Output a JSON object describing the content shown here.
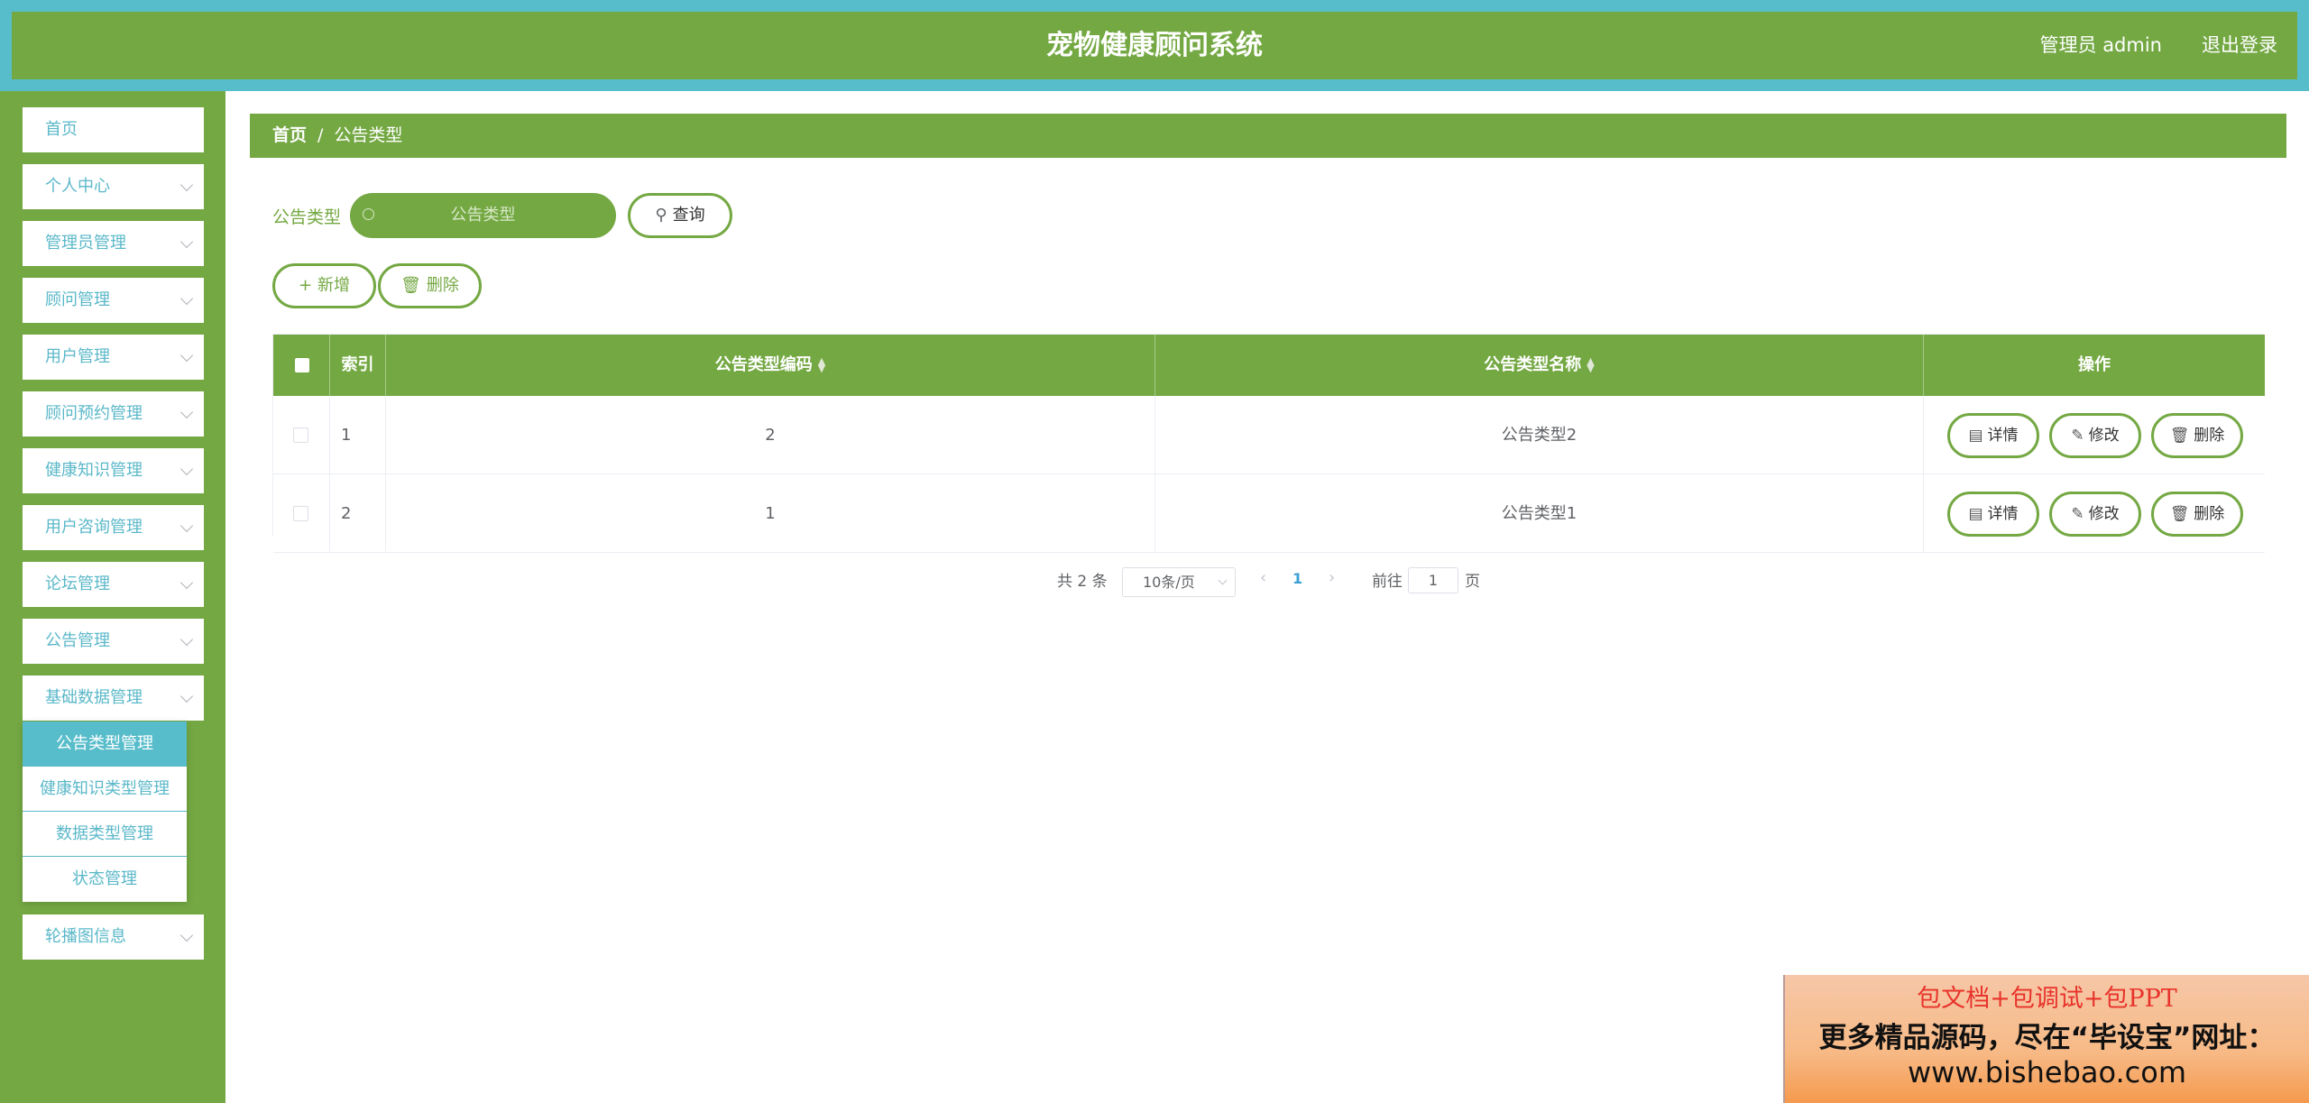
{
  "header": {
    "title": "宠物健康顾问系统",
    "user": "管理员 admin",
    "logout": "退出登录"
  },
  "sidebar": {
    "items": [
      {
        "label": "首页",
        "has_arrow": false
      },
      {
        "label": "个人中心",
        "has_arrow": true
      },
      {
        "label": "管理员管理",
        "has_arrow": true
      },
      {
        "label": "顾问管理",
        "has_arrow": true
      },
      {
        "label": "用户管理",
        "has_arrow": true
      },
      {
        "label": "顾问预约管理",
        "has_arrow": true
      },
      {
        "label": "健康知识管理",
        "has_arrow": true
      },
      {
        "label": "用户咨询管理",
        "has_arrow": true
      },
      {
        "label": "论坛管理",
        "has_arrow": true
      },
      {
        "label": "公告管理",
        "has_arrow": true
      },
      {
        "label": "基础数据管理",
        "has_arrow": true
      },
      {
        "label": "轮播图信息",
        "has_arrow": true
      }
    ],
    "submenu": [
      {
        "label": "公告类型管理",
        "active": true
      },
      {
        "label": "健康知识类型管理",
        "active": false
      },
      {
        "label": "数据类型管理",
        "active": false
      },
      {
        "label": "状态管理",
        "active": false
      }
    ]
  },
  "breadcrumb": {
    "home": "首页",
    "separator": "/",
    "current": "公告类型"
  },
  "search": {
    "label": "公告类型",
    "placeholder": "公告类型",
    "query_button": "查询"
  },
  "toolbar": {
    "add_label": "新增",
    "delete_label": "删除"
  },
  "table": {
    "columns": {
      "index": "索引",
      "code": "公告类型编码",
      "name": "公告类型名称",
      "actions": "操作"
    },
    "rows": [
      {
        "index": "1",
        "code": "2",
        "name": "公告类型2"
      },
      {
        "index": "2",
        "code": "1",
        "name": "公告类型1"
      }
    ],
    "action_labels": {
      "detail": "详情",
      "edit": "修改",
      "delete": "删除"
    }
  },
  "pagination": {
    "total": "共 2 条",
    "page_size": "10条/页",
    "current_page": "1",
    "goto_label": "前往",
    "goto_value": "1",
    "page_suffix": "页"
  },
  "promo": {
    "line1": "包文档+包调试+包PPT",
    "line2": "更多精品源码，尽在“毕设宝”网址：",
    "line3": "www.bishebao.com"
  },
  "colors": {
    "header_bg": "#58bdca",
    "primary_green": "#74a843",
    "menu_text": "#5bb8c9"
  }
}
